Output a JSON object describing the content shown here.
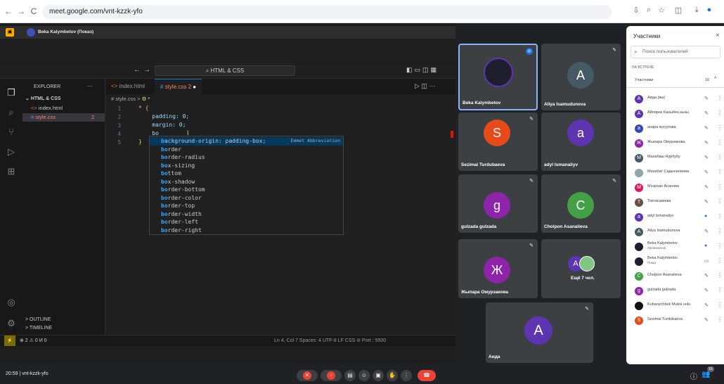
{
  "browser": {
    "url": "meet.google.com/vnt-kzzk-yfo",
    "back_icon": "←",
    "forward_icon": "→",
    "reload_icon": "C"
  },
  "presenter": {
    "name": "Beka Kalymbetov (Показ)"
  },
  "vscode": {
    "command_center": "HTML & CSS",
    "explorer_title": "EXPLORER",
    "folder": "HTML & CSS",
    "files": [
      {
        "name": "index.html",
        "icon": "<>"
      },
      {
        "name": "style.css",
        "icon": "#",
        "problems": "2"
      }
    ],
    "tabs": [
      {
        "label": "index.html",
        "icon": "<>"
      },
      {
        "label": "style.css 2",
        "icon": "#"
      }
    ],
    "breadcrumb": [
      "# style.css",
      ">",
      "⚙ *"
    ],
    "line_numbers": [
      "1",
      "2",
      "3",
      "4",
      "5"
    ],
    "code_lines": [
      "* {",
      "    padding: 0;",
      "    margin: 0;",
      "    bo",
      "}"
    ],
    "suggestions": [
      {
        "match": "b",
        "rest": "ackground-origin: padding-box;",
        "detail": "Emmet Abbreviation"
      },
      {
        "match": "bo",
        "rest": "rder"
      },
      {
        "match": "bo",
        "rest": "rder-radius"
      },
      {
        "match": "bo",
        "rest": "x-sizing"
      },
      {
        "match": "bo",
        "rest": "ttom"
      },
      {
        "match": "bo",
        "rest": "x-shadow"
      },
      {
        "match": "bo",
        "rest": "rder-bottom"
      },
      {
        "match": "bo",
        "rest": "rder-color"
      },
      {
        "match": "bo",
        "rest": "rder-top"
      },
      {
        "match": "bo",
        "rest": "rder-width"
      },
      {
        "match": "bo",
        "rest": "rder-left"
      },
      {
        "match": "bo",
        "rest": "rder-right"
      }
    ],
    "outline": "OUTLINE",
    "timeline": "TIMELINE",
    "status_left": "⊗ 2 ⚠ 0   И 0",
    "status_right": "Ln 4, Col 7   Spaces: 4   UTF-8   LF   CSS   ⊘ Port : 5500"
  },
  "tiles": [
    {
      "name": "Beka Kalymbetov",
      "letter": "",
      "color": "#1e1e2e",
      "highlight": true
    },
    {
      "name": "Aliya Isamudunova",
      "letter": "A",
      "color": "#455a64"
    },
    {
      "name": "Sezimai Turdubaeva",
      "letter": "S",
      "color": "#e64a19"
    },
    {
      "name": "adyl Ismanaliyv",
      "letter": "a",
      "color": "#5e35b1"
    },
    {
      "name": "gulzada gulzada",
      "letter": "g",
      "color": "#8e24aa"
    },
    {
      "name": "Cholpon Asanalieva",
      "letter": "C",
      "color": "#43a047"
    },
    {
      "name": "Жыпара Омурзакова",
      "letter": "Ж",
      "color": "#8e24aa"
    },
    {
      "name": "Ещё 7 чел.",
      "letter": "A",
      "color": "#5e35b1"
    },
    {
      "name": "Аида",
      "letter": "A",
      "color": "#5e35b1"
    }
  ],
  "panel": {
    "title": "Участники",
    "search_placeholder": "Поиск пользователей",
    "section": "НА ВСТРЕЧЕ",
    "group": "Участники",
    "count": "16",
    "people": [
      {
        "name": "Аида (вы)",
        "letter": "A",
        "color": "#5e35b1"
      },
      {
        "name": "Айпирек Каныбек кызы",
        "letter": "A",
        "color": "#5e35b1"
      },
      {
        "name": "анара жусупова",
        "letter": "a",
        "color": "#3949ab"
      },
      {
        "name": "Жыпара Омурзакова",
        "letter": "Ж",
        "color": "#8e24aa"
      },
      {
        "name": "Махабаш Нурбубу",
        "letter": "M",
        "color": "#455a64"
      },
      {
        "name": "Махабат Садыналиева",
        "letter": "",
        "color": "#90a4ae"
      },
      {
        "name": "Мээрхан Асанова",
        "letter": "M",
        "color": "#d81b60"
      },
      {
        "name": "Токтагазиева",
        "letter": "T",
        "color": "#6d4c41"
      },
      {
        "name": "adyl Ismanaliyv",
        "letter": "a",
        "color": "#5e35b1"
      },
      {
        "name": "Aliya Isamudunova",
        "letter": "A",
        "color": "#455a64"
      },
      {
        "name": "Beka Kalymbetov",
        "sub": "Организатор",
        "letter": "",
        "color": "#1e1e2e"
      },
      {
        "name": "Beka Kalymbetov",
        "sub": "Показ",
        "letter": "",
        "color": "#1e1e2e"
      },
      {
        "name": "Cholpon Asanalieva",
        "letter": "C",
        "color": "#43a047"
      },
      {
        "name": "gulzada gulzada",
        "letter": "g",
        "color": "#8e24aa"
      },
      {
        "name": "Kubanychbek Muksi uulu",
        "letter": "",
        "color": "#111111"
      },
      {
        "name": "Sezimai Turdubaeva",
        "letter": "S",
        "color": "#e64a19"
      }
    ]
  },
  "meeting": {
    "time": "20:59",
    "code": "vnt-kzzk-yfo",
    "participants_badge": "16"
  }
}
